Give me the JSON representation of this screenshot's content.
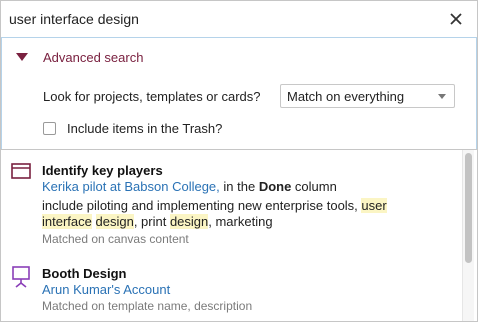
{
  "search": {
    "value": "user interface design"
  },
  "advanced": {
    "toggle_label": "Advanced search",
    "look_for_label": "Look for projects, templates or cards?",
    "match_select": {
      "selected": "Match on everything"
    },
    "trash_checkbox": {
      "label": "Include items in the Trash?",
      "checked": false
    }
  },
  "results": [
    {
      "icon": "canvas-window-icon",
      "title": "Identify key players",
      "project_link": "Kerika pilot at Babson College,",
      "column_pre": " in the ",
      "column_name": "Done",
      "column_post": " column",
      "desc_1": "include piloting and implementing new enterprise tools, ",
      "hl_1": "user interface",
      "desc_2": " ",
      "hl_2": "design",
      "desc_3": ", print ",
      "hl_3": "design",
      "desc_4": ", marketing",
      "matched": "Matched on canvas content"
    },
    {
      "icon": "presentation-board-icon",
      "title": "Booth Design",
      "account_link": "Arun Kumar's Account",
      "matched": "Matched on template name, description"
    }
  ],
  "colors": {
    "accent_maroon": "#7a2140",
    "link_blue": "#2a72b5",
    "highlight": "#fbf5c4",
    "icon_purple": "#8a3fb8"
  }
}
